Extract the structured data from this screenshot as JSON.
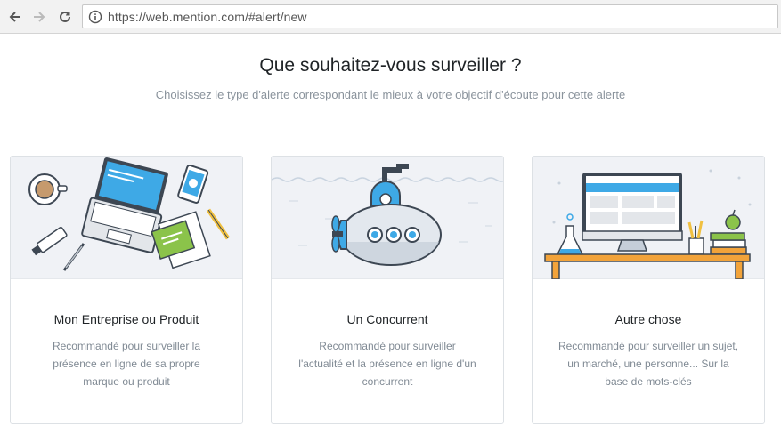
{
  "browser": {
    "url": "https://web.mention.com/#alert/new",
    "back_icon": "back-arrow-icon",
    "forward_icon": "forward-arrow-icon",
    "reload_icon": "reload-icon",
    "info_icon": "info-icon"
  },
  "header": {
    "title": "Que souhaitez-vous surveiller ?",
    "subtitle": "Choisissez le type d'alerte correspondant le mieux à votre objectif d'écoute pour cette alerte"
  },
  "cards": [
    {
      "title": "Mon Entreprise ou Produit",
      "description": "Recommandé pour surveiller la présence en ligne de sa propre marque ou produit",
      "illustration": "desk-laptop-illustration"
    },
    {
      "title": "Un Concurrent",
      "description": "Recommandé pour surveiller l'actualité et la présence en ligne d'un concurrent",
      "illustration": "submarine-illustration"
    },
    {
      "title": "Autre chose",
      "description": "Recommandé pour surveiller un sujet, un marché, une personne... Sur la base de mots-clés",
      "illustration": "computer-desk-illustration"
    }
  ],
  "colors": {
    "accent_blue": "#3ea9e6",
    "accent_green": "#8bc34a",
    "illustration_bg": "#f0f2f6",
    "card_border": "#dde1e5"
  }
}
